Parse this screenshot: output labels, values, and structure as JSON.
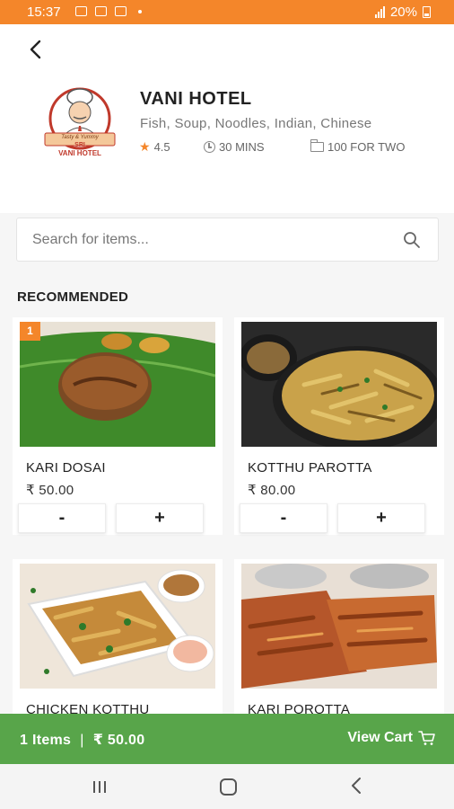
{
  "status_bar": {
    "time": "15:37",
    "battery": "20%"
  },
  "header": {
    "back_icon": "back-arrow-icon",
    "hotel_name": "VANI HOTEL",
    "cuisines": "Fish, Soup, Noodles, Indian, Chinese",
    "rating": "4.5",
    "delivery_time": "30 MINS",
    "cost_for_two": "100 FOR TWO",
    "logo": {
      "line1": "Tasty & Yummy",
      "line2": "SRI",
      "line3": "VANI HOTEL"
    }
  },
  "search": {
    "placeholder": "Search for items..."
  },
  "section_title": "RECOMMENDED",
  "items": [
    {
      "name": "KARI DOSAI",
      "price": "₹ 50.00",
      "badge": "1",
      "minus_label": "-",
      "plus_label": "+"
    },
    {
      "name": "KOTTHU PAROTTA",
      "price": "₹ 80.00",
      "minus_label": "-",
      "plus_label": "+"
    },
    {
      "name": "CHICKEN KOTTHU"
    },
    {
      "name": "KARI POROTTA"
    }
  ],
  "cart": {
    "items_label": "1 Items",
    "separator": "|",
    "total": "₹ 50.00",
    "view_cart_label": "View Cart"
  },
  "colors": {
    "accent": "#f4862a",
    "cart_bar": "#58a54a",
    "background": "#f6f6f6"
  }
}
